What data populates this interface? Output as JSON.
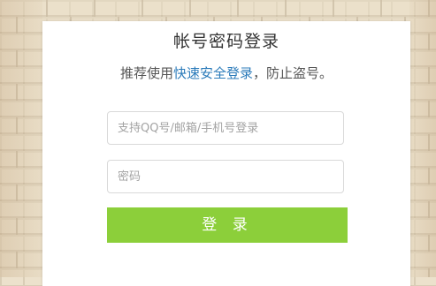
{
  "login": {
    "title": "帐号密码登录",
    "subtitle_prefix": "推荐使用",
    "subtitle_link": "快速安全登录",
    "subtitle_suffix": "，防止盗号。",
    "account_placeholder": "支持QQ号/邮箱/手机号登录",
    "password_placeholder": "密码",
    "login_button": "登 录"
  },
  "colors": {
    "link": "#2b7bba",
    "button": "#8ccf3a",
    "background": "brick-wall"
  }
}
